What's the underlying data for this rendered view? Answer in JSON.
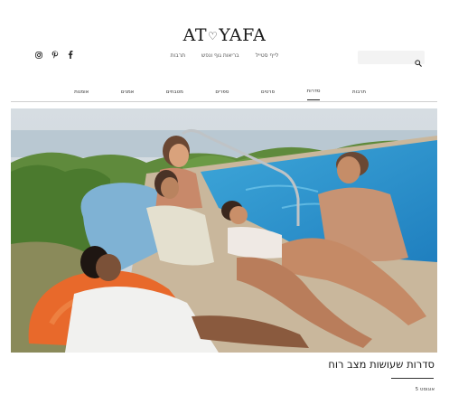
{
  "header": {
    "logo_left": "AT",
    "logo_heart": "♡",
    "logo_right": "YAFA",
    "top_links": [
      "לייף סטייל",
      "בריאות גוף ונפש",
      "תרבות"
    ]
  },
  "social": {
    "icons": [
      "facebook-icon",
      "pinterest-icon",
      "instagram-icon"
    ]
  },
  "search": {
    "placeholder": "",
    "icon": "search-icon"
  },
  "categories": {
    "items": [
      "תרבות",
      "סדרות",
      "סרטים",
      "ספרים",
      "מטבחים",
      "אמנים",
      "אומנות"
    ],
    "active": "סדרות"
  },
  "hero": {
    "image": "photo-women-laughing-by-pool"
  },
  "article": {
    "title": "סדרות שעושות מצב רוח",
    "meta": "אוגוסט 5"
  },
  "colors": {
    "accent": "#222222",
    "divider": "#cfcfcf",
    "search_bg": "#f3f3f3"
  }
}
